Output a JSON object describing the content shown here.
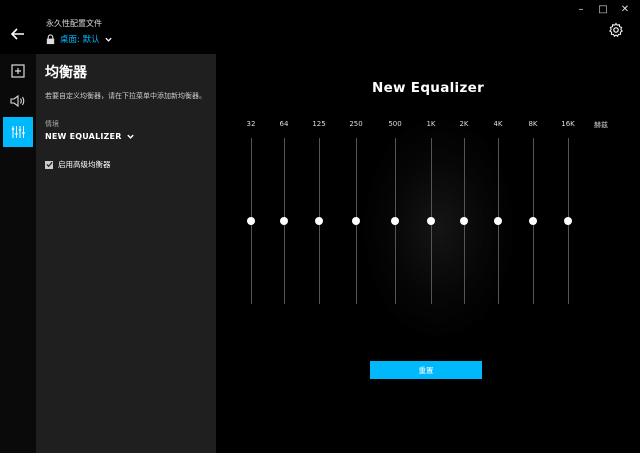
{
  "window": {
    "minimize": "–",
    "maximize": "□",
    "close": "✕"
  },
  "header": {
    "caption": "永久性配置文件",
    "profile": "桌面: 默认"
  },
  "rail": {
    "items": [
      {
        "name": "add",
        "active": false
      },
      {
        "name": "audio",
        "active": false
      },
      {
        "name": "equalizer",
        "active": true
      }
    ]
  },
  "panel": {
    "title": "均衡器",
    "description": "若要自定义均衡器，请在下拉菜单中添加新均衡器。",
    "preset_label": "情境",
    "preset_value": "NEW EQUALIZER",
    "advanced_label": "启用高级均衡器",
    "advanced_checked": true
  },
  "equalizer": {
    "title": "New Equalizer",
    "unit_label": "赫兹",
    "bands": [
      {
        "freq": "32",
        "gain": 0
      },
      {
        "freq": "64",
        "gain": 0
      },
      {
        "freq": "125",
        "gain": 0
      },
      {
        "freq": "250",
        "gain": 0
      },
      {
        "freq": "500",
        "gain": 0
      },
      {
        "freq": "1K",
        "gain": 0
      },
      {
        "freq": "2K",
        "gain": 0
      },
      {
        "freq": "4K",
        "gain": 0
      },
      {
        "freq": "8K",
        "gain": 0
      },
      {
        "freq": "16K",
        "gain": 0
      }
    ],
    "gain_range": [
      -12,
      12
    ],
    "reset_label": "重置"
  },
  "colors": {
    "accent": "#00b8fc",
    "panel": "#1f1f1f",
    "background": "#000000"
  }
}
